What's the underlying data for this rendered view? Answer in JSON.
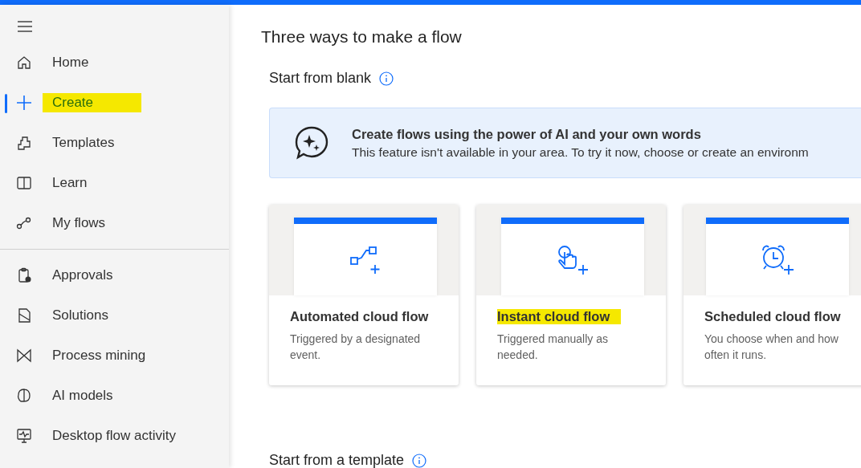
{
  "nav": {
    "groups": [
      [
        {
          "label": "Home",
          "kind": "home",
          "selected": false,
          "highlighted": false
        },
        {
          "label": "Create",
          "kind": "plus",
          "selected": true,
          "highlighted": true
        },
        {
          "label": "Templates",
          "kind": "templates",
          "selected": false,
          "highlighted": false
        },
        {
          "label": "Learn",
          "kind": "book",
          "selected": false,
          "highlighted": false
        },
        {
          "label": "My flows",
          "kind": "flows",
          "selected": false,
          "highlighted": false
        }
      ],
      [
        {
          "label": "Approvals",
          "kind": "clipboard",
          "selected": false,
          "highlighted": false
        },
        {
          "label": "Solutions",
          "kind": "solutions",
          "selected": false,
          "highlighted": false
        },
        {
          "label": "Process mining",
          "kind": "mining",
          "selected": false,
          "highlighted": false
        },
        {
          "label": "AI models",
          "kind": "brain",
          "selected": false,
          "highlighted": false
        },
        {
          "label": "Desktop flow activity",
          "kind": "monitor",
          "selected": false,
          "highlighted": false
        }
      ]
    ]
  },
  "main": {
    "title": "Three ways to make a flow",
    "blank_section": {
      "heading": "Start from blank",
      "banner": {
        "title": "Create flows using the power of AI and your own words",
        "text": "This feature isn't available in your area. To try it now, choose or create an environm"
      },
      "cards": [
        {
          "kind": "automated",
          "title": "Automated cloud flow",
          "description": "Triggered by a designated event.",
          "highlighted": false
        },
        {
          "kind": "instant",
          "title": "Instant cloud flow",
          "description": "Triggered manually as needed.",
          "highlighted": true
        },
        {
          "kind": "scheduled",
          "title": "Scheduled cloud flow",
          "description": "You choose when and how often it runs.",
          "highlighted": false
        }
      ]
    },
    "template_section": {
      "heading": "Start from a template"
    }
  }
}
